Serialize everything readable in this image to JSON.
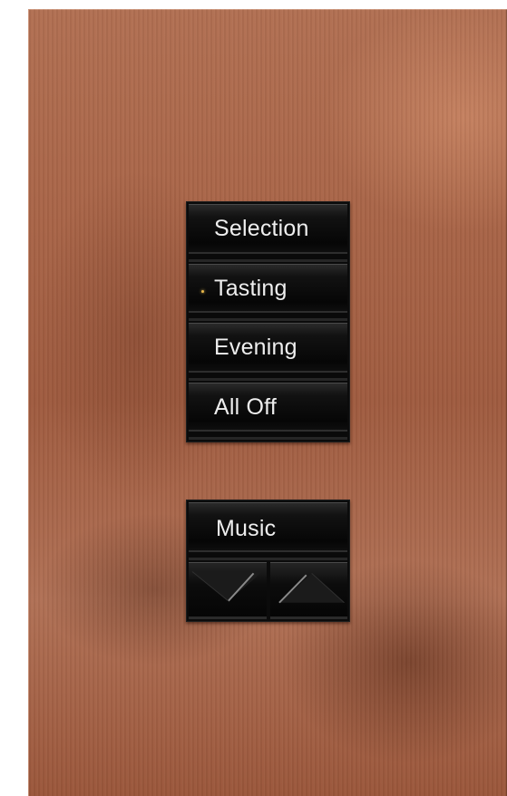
{
  "keypad": {
    "buttons": [
      {
        "label": "Selection",
        "led_on": false
      },
      {
        "label": "Tasting",
        "led_on": true
      },
      {
        "label": "Evening",
        "led_on": false
      },
      {
        "label": "All Off",
        "led_on": false
      }
    ],
    "music": {
      "label": "Music",
      "lower_icon": "lower-ramp-icon",
      "raise_icon": "raise-ramp-icon"
    }
  },
  "colors": {
    "faceplate": "#a96548",
    "button_face": "#0b0b0b",
    "button_text": "#eeeeee",
    "led_active": "#e9b84a"
  }
}
